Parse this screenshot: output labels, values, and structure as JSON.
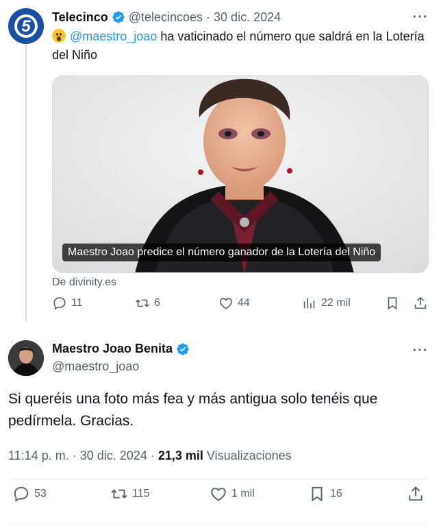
{
  "parent_tweet": {
    "author_name": "Telecinco",
    "handle": "@telecincoes",
    "separator": "·",
    "date": "30 dic. 2024",
    "text_mention": "@maestro_joao",
    "text_rest": " ha vaticinado el número que saldrá en la Lotería del Niño",
    "avatar_logo": "5",
    "card": {
      "caption": "Maestro Joao predice el número ganador de la Lotería del Niño",
      "source": "De divinity.es"
    },
    "stats": {
      "replies": "11",
      "reposts": "6",
      "likes": "44",
      "views": "22 mil"
    }
  },
  "main_tweet": {
    "author_name": "Maestro Joao Benita",
    "handle": "@maestro_joao",
    "text": "Si queréis una foto más fea y más antigua solo tenéis que pedírmela. Gracias.",
    "time": "11:14 p. m.",
    "separator": "·",
    "date": "30 dic. 2024",
    "separator2": "·",
    "views_count": "21,3 mil",
    "views_label": "Visualizaciones",
    "stats": {
      "replies": "53",
      "reposts": "115",
      "likes": "1 mil",
      "bookmarks": "16"
    }
  },
  "icons": {
    "more": "more-icon",
    "verified": "verified-badge-icon",
    "reply": "reply-icon",
    "repost": "repost-icon",
    "like": "like-icon",
    "views": "views-icon",
    "bookmark": "bookmark-icon",
    "share": "share-icon"
  },
  "colors": {
    "accent": "#1d9bf0",
    "text": "#0f1419",
    "muted": "#536471",
    "border": "#cfd9de"
  }
}
